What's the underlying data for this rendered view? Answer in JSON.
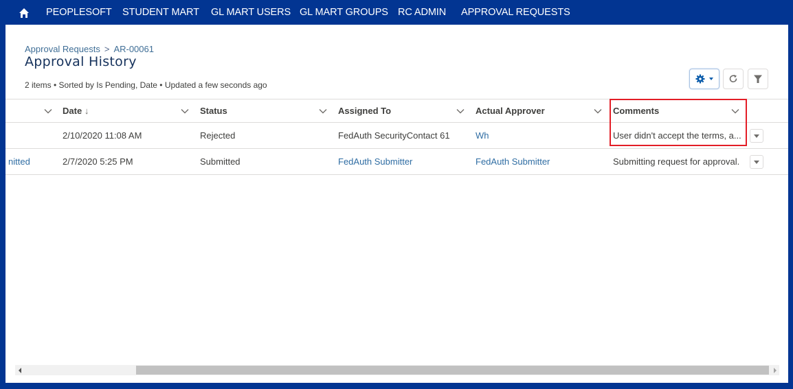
{
  "nav": {
    "home_icon": "home-icon",
    "items": [
      "PEOPLESOFT",
      "STUDENT MART",
      "GL MART USERS",
      "GL MART GROUPS",
      "RC ADMIN",
      "APPROVAL REQUESTS"
    ]
  },
  "breadcrumb": {
    "parent": "Approval Requests",
    "separator": ">",
    "current": "AR-00061"
  },
  "page_title": "Approval History",
  "meta": "2 items • Sorted by Is Pending, Date • Updated a few seconds ago",
  "toolbar": {
    "settings_icon": "gear-icon",
    "refresh_icon": "refresh-icon",
    "filter_icon": "filter-icon"
  },
  "table": {
    "columns": [
      "Date",
      "Status",
      "Assigned To",
      "Actual Approver",
      "Comments"
    ],
    "sort_indicator": "↓",
    "rows": [
      {
        "first": "",
        "date": "2/10/2020 11:08 AM",
        "status": "Rejected",
        "assigned_to": "FedAuth SecurityContact 61",
        "actual_approver": "Wh",
        "comments": "User didn't accept the terms, a..."
      },
      {
        "first": "nitted",
        "date": "2/7/2020 5:25 PM",
        "status": "Submitted",
        "assigned_to": "FedAuth Submitter",
        "actual_approver": "FedAuth Submitter",
        "comments": "Submitting request for approval."
      }
    ]
  },
  "colors": {
    "nav_bg": "#023592",
    "link": "#2f6da3",
    "highlight": "#e31d26"
  }
}
